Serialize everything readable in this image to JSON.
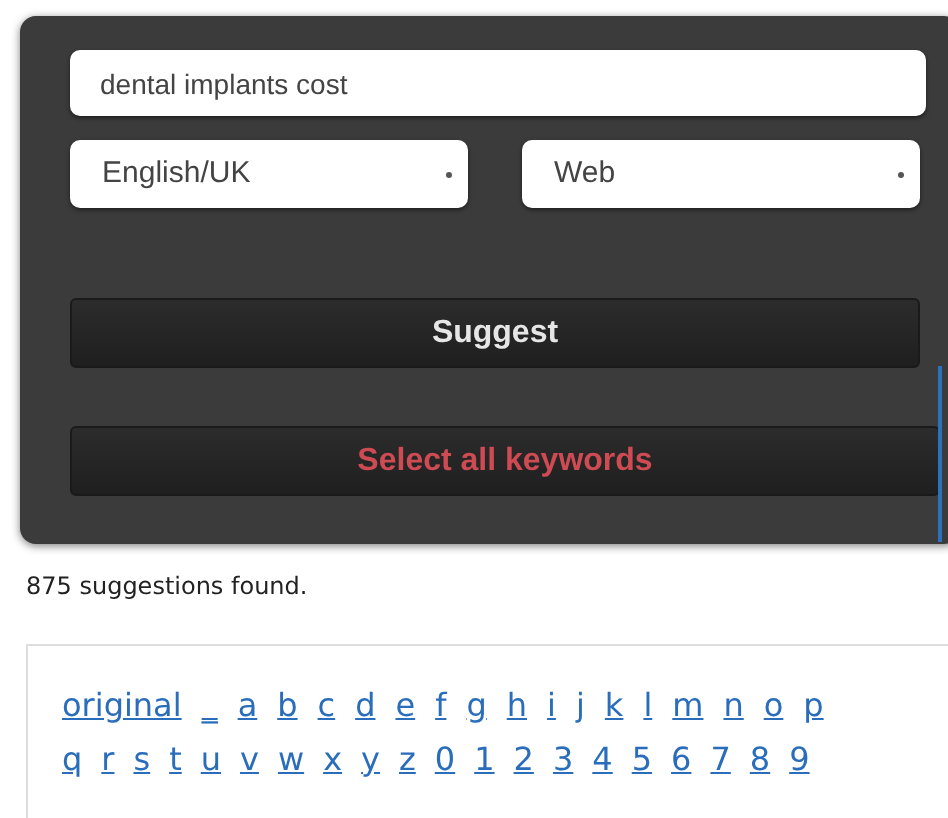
{
  "search": {
    "value": "dental implants cost"
  },
  "language_select": {
    "value": "English/UK"
  },
  "source_select": {
    "value": "Web"
  },
  "buttons": [
    {
      "label": "Suggest",
      "kind": "primary"
    },
    {
      "label": "Select all keywords",
      "kind": "danger"
    }
  ],
  "status": "875 suggestions found.",
  "link_rows": [
    [
      "original",
      "_",
      "a",
      "b",
      "c",
      "d",
      "e",
      "f",
      "g",
      "h",
      "i",
      "j",
      "k",
      "l",
      "m",
      "n",
      "o",
      "p"
    ],
    [
      "q",
      "r",
      "s",
      "t",
      "u",
      "v",
      "w",
      "x",
      "y",
      "z",
      "0",
      "1",
      "2",
      "3",
      "4",
      "5",
      "6",
      "7",
      "8",
      "9"
    ]
  ]
}
